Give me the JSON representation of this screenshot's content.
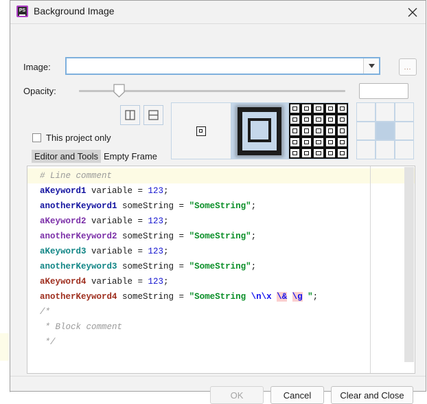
{
  "window": {
    "title": "Background Image",
    "app_icon": "phpstorm-icon",
    "close_icon": "close-icon"
  },
  "form": {
    "image": {
      "label": "Image:",
      "value": "",
      "placeholder": "",
      "dropdown_icon": "chevron-down-icon",
      "browse_label": "..."
    },
    "opacity": {
      "label": "Opacity:",
      "value": "15",
      "min": 0,
      "max": 100,
      "percent": 15
    },
    "this_project_only": {
      "label": "This project only",
      "checked": false
    }
  },
  "split_buttons": [
    {
      "name": "split-vertical",
      "icon": "split-vertical-icon",
      "tooltip": "Split Vertically"
    },
    {
      "name": "split-horizontal",
      "icon": "split-horizontal-icon",
      "tooltip": "Split Horizontally"
    }
  ],
  "tabs": [
    {
      "label": "Editor and Tools",
      "selected": true
    },
    {
      "label": "Empty Frame",
      "selected": false
    }
  ],
  "fill_modes": [
    {
      "name": "preview-center",
      "icon": "center-fill-icon",
      "selected": false
    },
    {
      "name": "preview-scale",
      "icon": "scale-fill-icon",
      "selected": true
    },
    {
      "name": "preview-tile",
      "icon": "tile-fill-icon",
      "selected": false
    }
  ],
  "anchor_grid": {
    "selected_index": 4,
    "cells": [
      "top-left",
      "top-center",
      "top-right",
      "middle-left",
      "middle-center",
      "middle-right",
      "bottom-left",
      "bottom-center",
      "bottom-right"
    ]
  },
  "code_preview": {
    "lines": [
      {
        "highlight": true,
        "tokens": [
          {
            "t": "# Line comment",
            "c": "tok-comment"
          }
        ]
      },
      {
        "highlight": false,
        "tokens": [
          {
            "t": "aKeyword1",
            "c": "tok-kw-navy"
          },
          {
            "t": " variable = ",
            "c": "tok-var"
          },
          {
            "t": "123",
            "c": "tok-num"
          },
          {
            "t": ";",
            "c": "tok-var"
          }
        ]
      },
      {
        "highlight": false,
        "tokens": [
          {
            "t": "anotherKeyword1",
            "c": "tok-kw-navy"
          },
          {
            "t": " someString = ",
            "c": "tok-var"
          },
          {
            "t": "\"SomeString\"",
            "c": "tok-str"
          },
          {
            "t": ";",
            "c": "tok-var"
          }
        ]
      },
      {
        "highlight": false,
        "tokens": [
          {
            "t": "aKeyword2",
            "c": "tok-kw-purple"
          },
          {
            "t": " variable = ",
            "c": "tok-var"
          },
          {
            "t": "123",
            "c": "tok-num"
          },
          {
            "t": ";",
            "c": "tok-var"
          }
        ]
      },
      {
        "highlight": false,
        "tokens": [
          {
            "t": "anotherKeyword2",
            "c": "tok-kw-purple"
          },
          {
            "t": " someString = ",
            "c": "tok-var"
          },
          {
            "t": "\"SomeString\"",
            "c": "tok-str"
          },
          {
            "t": ";",
            "c": "tok-var"
          }
        ]
      },
      {
        "highlight": false,
        "tokens": [
          {
            "t": "aKeyword3",
            "c": "tok-kw-teal"
          },
          {
            "t": " variable = ",
            "c": "tok-var"
          },
          {
            "t": "123",
            "c": "tok-num"
          },
          {
            "t": ";",
            "c": "tok-var"
          }
        ]
      },
      {
        "highlight": false,
        "tokens": [
          {
            "t": "anotherKeyword3",
            "c": "tok-kw-teal"
          },
          {
            "t": " someString = ",
            "c": "tok-var"
          },
          {
            "t": "\"SomeString\"",
            "c": "tok-str"
          },
          {
            "t": ";",
            "c": "tok-var"
          }
        ]
      },
      {
        "highlight": false,
        "tokens": [
          {
            "t": "aKeyword4",
            "c": "tok-kw-red"
          },
          {
            "t": " variable = ",
            "c": "tok-var"
          },
          {
            "t": "123",
            "c": "tok-num"
          },
          {
            "t": ";",
            "c": "tok-var"
          }
        ]
      },
      {
        "highlight": false,
        "tokens": [
          {
            "t": "anotherKeyword4",
            "c": "tok-kw-red"
          },
          {
            "t": " someString = ",
            "c": "tok-var"
          },
          {
            "t": "\"SomeString ",
            "c": "tok-str"
          },
          {
            "t": "\\n\\x",
            "c": "tok-esc"
          },
          {
            "t": " ",
            "c": "tok-str"
          },
          {
            "t": "\\&",
            "c": "tok-bad"
          },
          {
            "t": " ",
            "c": "tok-str"
          },
          {
            "t": "\\g",
            "c": "tok-bad"
          },
          {
            "t": " \"",
            "c": "tok-str"
          },
          {
            "t": ";",
            "c": "tok-var"
          }
        ]
      },
      {
        "highlight": false,
        "tokens": [
          {
            "t": "/*",
            "c": "tok-comment"
          }
        ]
      },
      {
        "highlight": false,
        "tokens": [
          {
            "t": " * Block comment",
            "c": "tok-comment"
          }
        ]
      },
      {
        "highlight": false,
        "tokens": [
          {
            "t": " */",
            "c": "tok-comment"
          }
        ]
      }
    ]
  },
  "footer": {
    "ok_label": "OK",
    "ok_enabled": false,
    "cancel_label": "Cancel",
    "clear_close_label": "Clear and Close"
  },
  "colors": {
    "dialog_bg": "#f2f2f2",
    "focus_border": "#7eb0dd",
    "selection_blue": "#bcd0e4",
    "modified_value": "#a85c1c",
    "comment": "#9a9a9a",
    "string": "#0a8f28",
    "number": "#1414d0",
    "keyword_navy": "#1414a0",
    "keyword_purple": "#7b2fa8",
    "keyword_teal": "#128686",
    "keyword_red": "#9e2e1e",
    "error_bg": "#fbcfcf",
    "highlight_line": "#fdfbe4"
  }
}
